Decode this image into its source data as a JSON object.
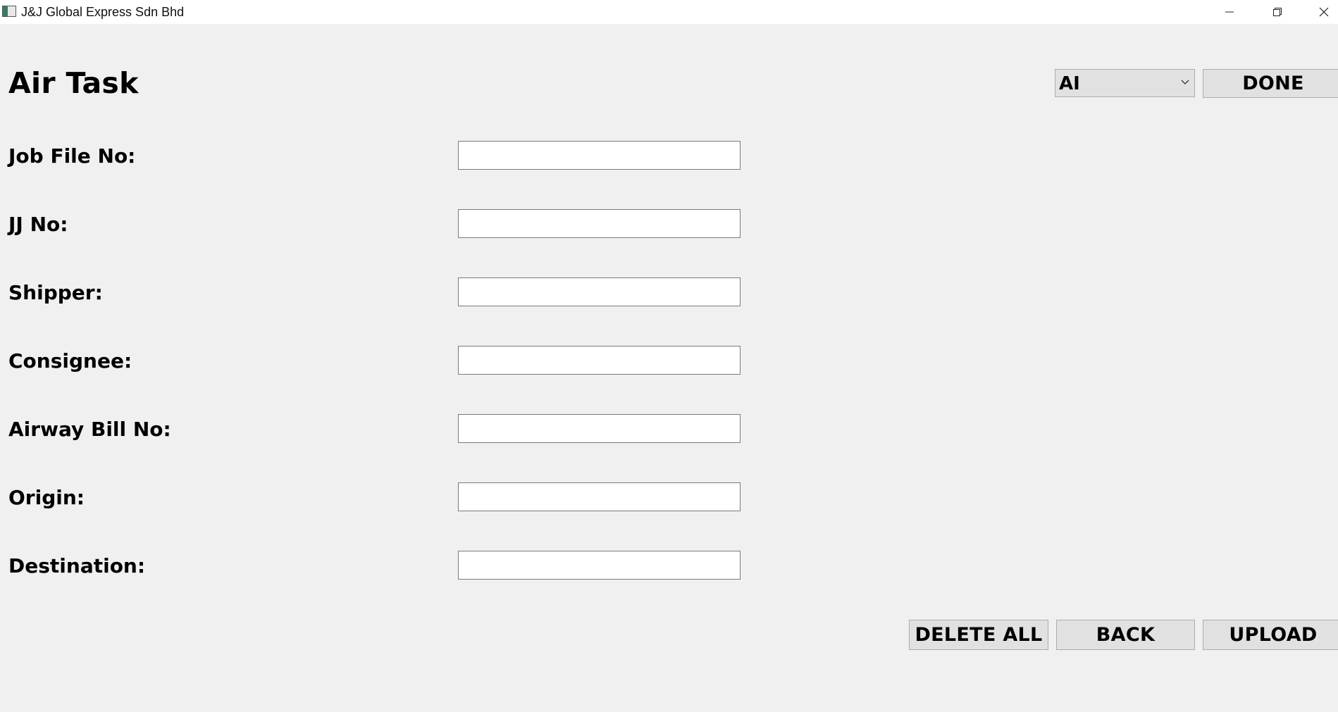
{
  "window": {
    "title": "J&J Global Express Sdn Bhd"
  },
  "page": {
    "title": "Air Task"
  },
  "header": {
    "mode_select": {
      "selected": "AI"
    },
    "done_label": "DONE"
  },
  "form": {
    "fields": [
      {
        "label": "Job File No:",
        "value": ""
      },
      {
        "label": "JJ No:",
        "value": ""
      },
      {
        "label": "Shipper:",
        "value": ""
      },
      {
        "label": "Consignee:",
        "value": ""
      },
      {
        "label": "Airway Bill No:",
        "value": ""
      },
      {
        "label": "Origin:",
        "value": ""
      },
      {
        "label": "Destination:",
        "value": ""
      }
    ]
  },
  "actions": {
    "delete_all_label": "DELETE ALL",
    "back_label": "BACK",
    "upload_label": "UPLOAD"
  }
}
